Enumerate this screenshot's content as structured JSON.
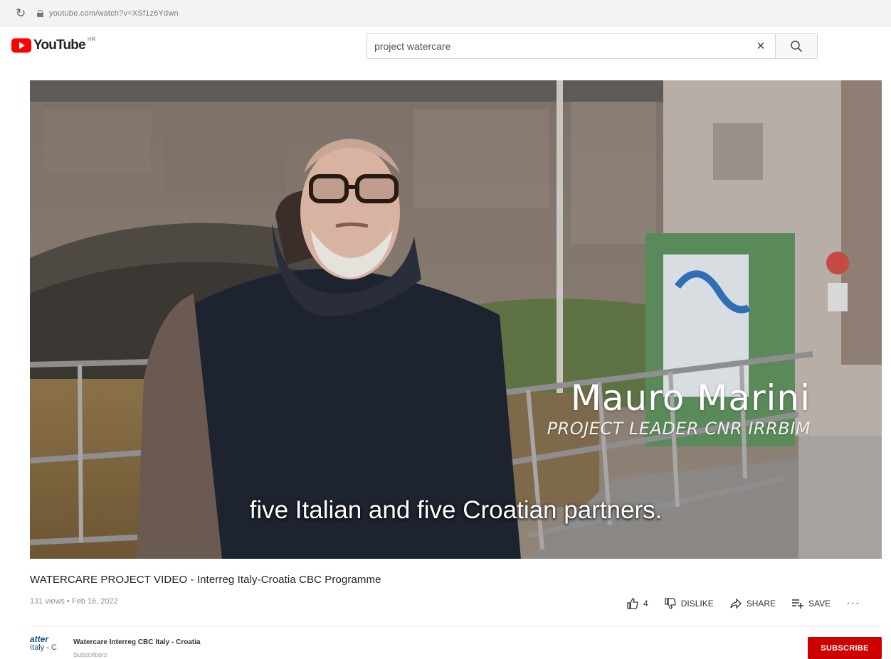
{
  "browser": {
    "url": "youtube.com/watch?v=XSf1z6Ydwn"
  },
  "header": {
    "logo_text": "YouTube",
    "logo_sup": "HR",
    "search_value": "project watercare",
    "clear_glyph": "×"
  },
  "video": {
    "lower_third_name": "Mauro Marini",
    "lower_third_role": "PROJECT LEADER CNR IRRBIM",
    "subtitle": "five Italian and five Croatian partners."
  },
  "info": {
    "title": "WATERCARE PROJECT VIDEO - Interreg Italy-Croatia CBC Programme",
    "meta": "131 views • Feb 16, 2022",
    "like_count": "4",
    "dislike_label": "DISLIKE",
    "share_label": "SHARE",
    "save_label": "SAVE",
    "more_glyph": "···"
  },
  "channel": {
    "avatar_line1": "atter",
    "avatar_line2": "Italy - C",
    "name": "Watercare Interreg CBC Italy - Croatia",
    "subscribers": "Subscribers",
    "subscribe_label": "SUBSCRIBE"
  },
  "colors": {
    "brand_red": "#ff0000",
    "subscribe_red": "#cc0000"
  },
  "icons": [
    "reload-icon",
    "lock-icon",
    "youtube-logo-icon",
    "clear-icon",
    "search-icon",
    "like-icon",
    "dislike-icon",
    "share-icon",
    "save-icon",
    "more-icon"
  ]
}
